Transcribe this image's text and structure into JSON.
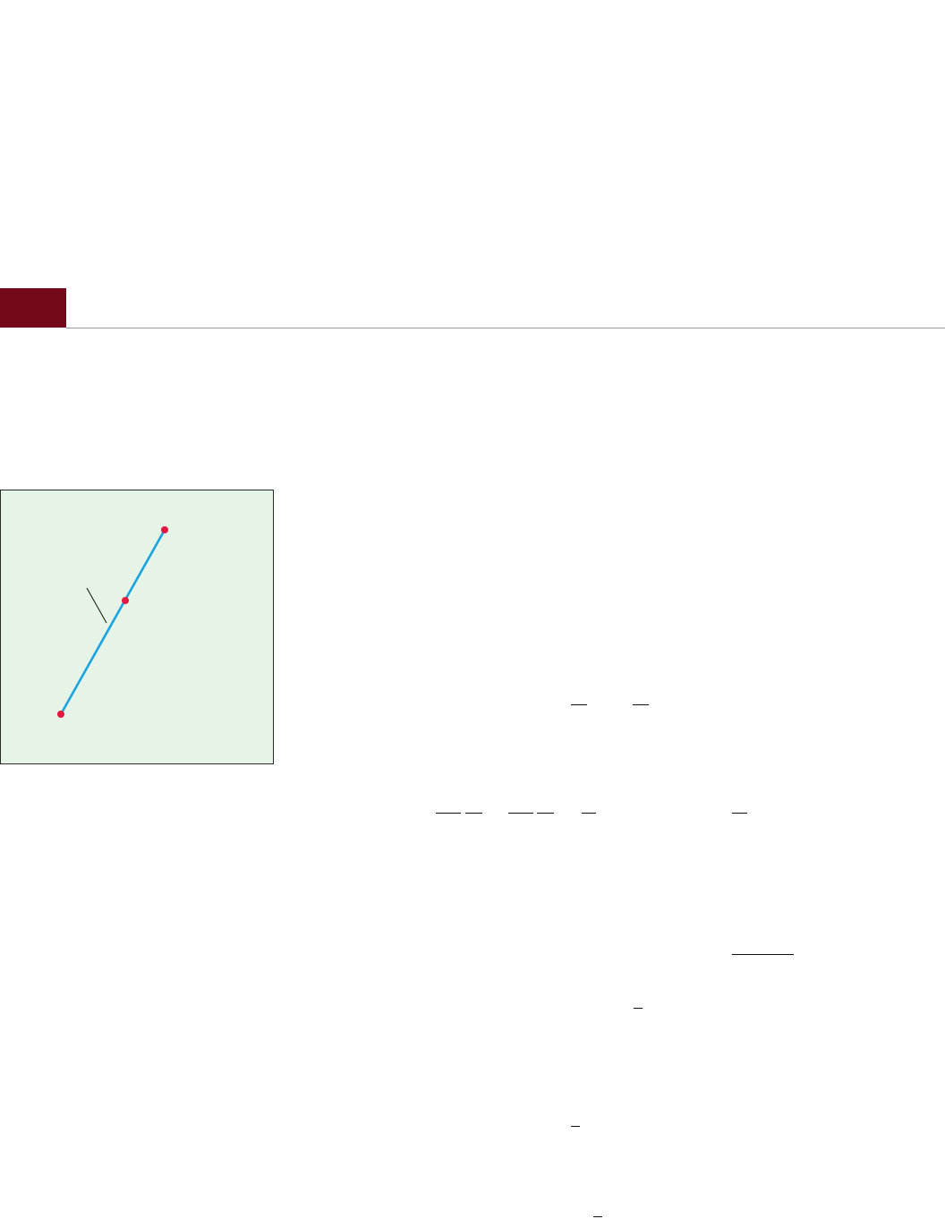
{
  "section_header": {
    "accent_color": "#75091c",
    "rule_color": "#9a9a9a"
  },
  "figure": {
    "background_color": "#e5f4e6",
    "segment_color": "#1aa3e0",
    "point_color": "#e3173f",
    "points": [
      "endpoint-top",
      "midpoint",
      "endpoint-bottom"
    ]
  }
}
